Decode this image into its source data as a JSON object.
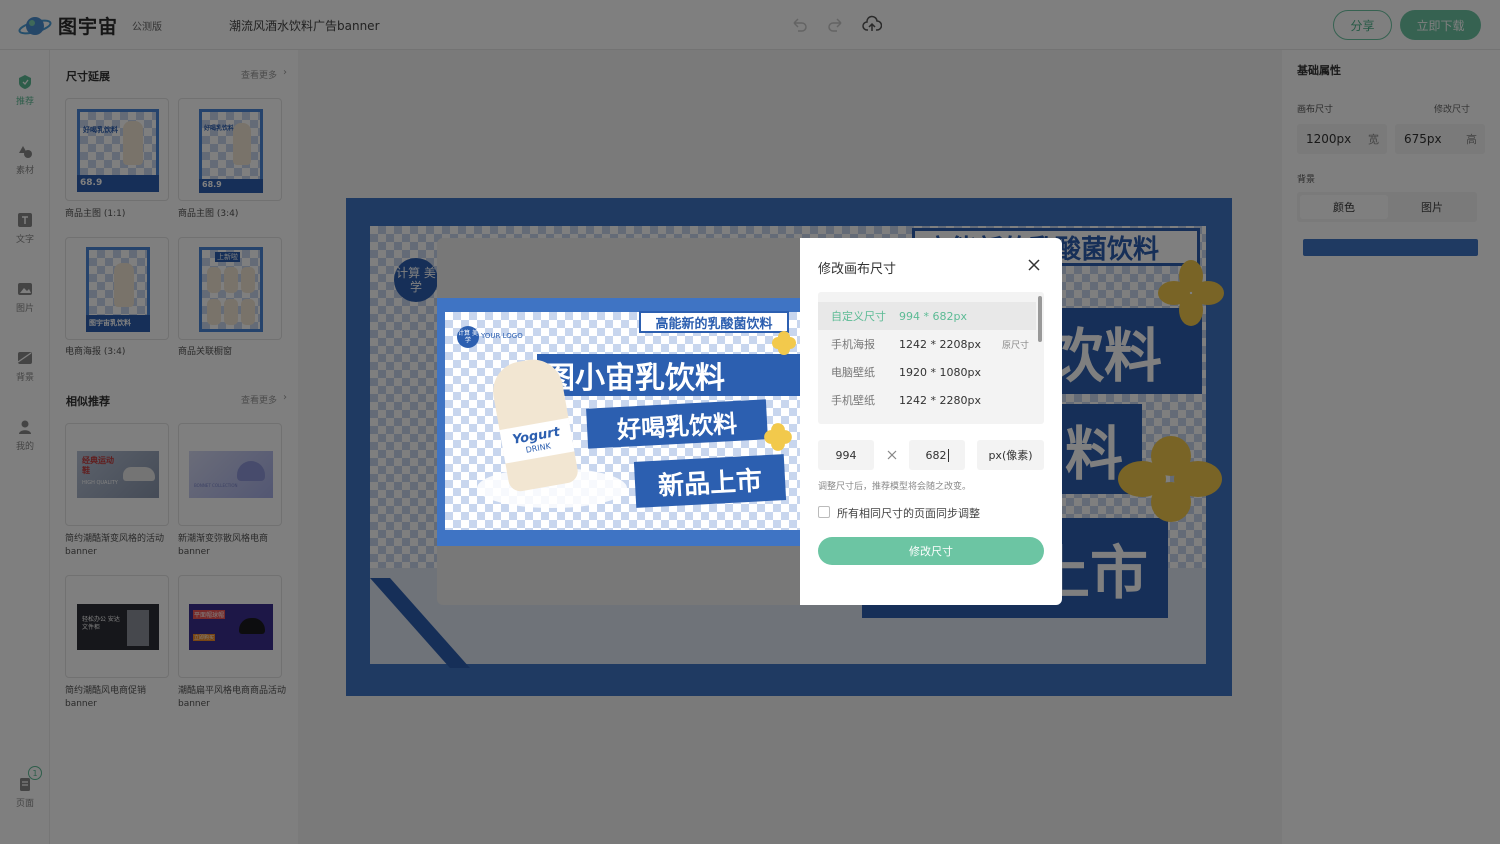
{
  "app": {
    "name": "图宇宙",
    "badge": "公测版",
    "doc_title": "潮流风酒水饮料广告banner"
  },
  "toolbar": {
    "share_label": "分享",
    "download_label": "立即下载"
  },
  "rail": {
    "items": [
      {
        "label": "推荐",
        "icon": "recommend-icon"
      },
      {
        "label": "素材",
        "icon": "shapes-icon"
      },
      {
        "label": "文字",
        "icon": "text-icon"
      },
      {
        "label": "图片",
        "icon": "image-icon"
      },
      {
        "label": "背景",
        "icon": "background-icon"
      },
      {
        "label": "我的",
        "icon": "user-icon"
      }
    ],
    "pages_label": "页面",
    "pages_count": "1"
  },
  "panel": {
    "section1": {
      "title": "尺寸延展",
      "more": "查看更多",
      "items": [
        {
          "label": "商品主图 (1:1)",
          "price": "68.9",
          "thumb_text": "好喝乳饮料",
          "thumb_sub": "TIME: 9月2日-10月11日"
        },
        {
          "label": "商品主图 (3:4)",
          "price": "68.9",
          "thumb_text": "好喝乳饮料"
        },
        {
          "label": "电商海报 (3:4)",
          "thumb_text": "图宇宙乳饮料"
        },
        {
          "label": "商品关联橱窗",
          "thumb_text": "上新啦"
        }
      ]
    },
    "section2": {
      "title": "相似推荐",
      "more": "查看更多",
      "items": [
        {
          "label": "简约潮酷渐变风格的活动banner",
          "thumb_text": "经典运动鞋",
          "thumb_sub": "HIGH QUALITY"
        },
        {
          "label": "新潮渐变弥散风格电商banner",
          "thumb_text": "BONNET COLLECTION"
        },
        {
          "label": "简约潮酷风电商促销banner",
          "thumb_text": "轻松办公 安达文件柜"
        },
        {
          "label": "潮酷扁平风格电商商品活动banner",
          "thumb_text": "平面帽球帽",
          "thumb_sub": "立即购买"
        }
      ]
    }
  },
  "right_panel": {
    "title": "基础属性",
    "canvas_size_label": "画布尺寸",
    "change_size_label": "修改尺寸",
    "width_value": "1200px",
    "width_unit": "宽",
    "height_value": "675px",
    "height_unit": "高",
    "bg_label": "背景",
    "bg_tabs": [
      "颜色",
      "图片"
    ],
    "bg_color": "#3f74c4"
  },
  "canvas": {
    "headline": "高能新的乳酸菌饮料",
    "big_chars_1": "饮料",
    "big_char_2": "料",
    "big_chars_3": "上市",
    "badge": "计算 美学"
  },
  "preview": {
    "logo_badge": "计算 美学",
    "logo_text": "YOUR LOGO",
    "top_banner": "高能新的乳酸菌饮料",
    "main_title": "图小宙乳饮料",
    "sub_title_1": "好喝乳饮料",
    "sub_title_2": "新品上市",
    "bottle_text_1": "Yogurt",
    "bottle_text_2": "DRINK"
  },
  "modal": {
    "title": "修改画布尺寸",
    "options": [
      {
        "name": "自定义尺寸",
        "size": "994 * 682px",
        "tag": "",
        "selected": true
      },
      {
        "name": "手机海报",
        "size": "1242 * 2208px",
        "tag": "原尺寸",
        "selected": false
      },
      {
        "name": "电脑壁纸",
        "size": "1920 * 1080px",
        "tag": "",
        "selected": false
      },
      {
        "name": "手机壁纸",
        "size": "1242 * 2280px",
        "tag": "",
        "selected": false
      }
    ],
    "width_input": "994",
    "height_input": "682",
    "unit": "px(像素)",
    "hint": "调整尺寸后，推荐模型将会随之改变。",
    "sync_label": "所有相同尺寸的页面同步调整",
    "submit_label": "修改尺寸",
    "accent": "#6cc5a3"
  }
}
